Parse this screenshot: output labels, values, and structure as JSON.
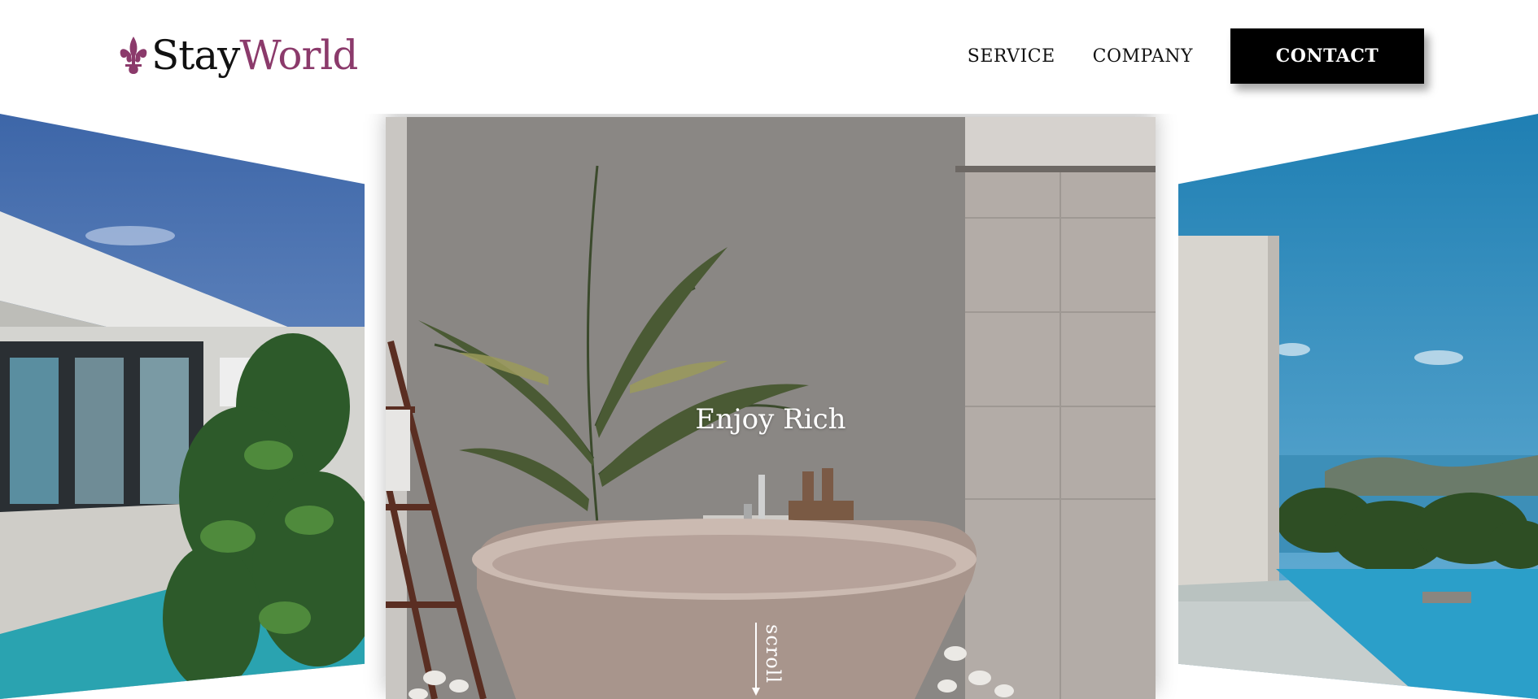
{
  "brand": {
    "name_part1": "Stay",
    "name_part2": "World",
    "accent_color": "#8b3a6b"
  },
  "nav": {
    "items": [
      {
        "label": "SERVICE"
      },
      {
        "label": "COMPANY"
      }
    ],
    "contact_label": "CONTACT"
  },
  "hero": {
    "title": "Enjoy Rich",
    "scroll_label": "scroll"
  },
  "slides": [
    {
      "scene": "modern-villa-with-plant-and-pool"
    },
    {
      "scene": "outdoor-bathtub-with-palm"
    },
    {
      "scene": "infinity-pool-sea-view"
    }
  ]
}
